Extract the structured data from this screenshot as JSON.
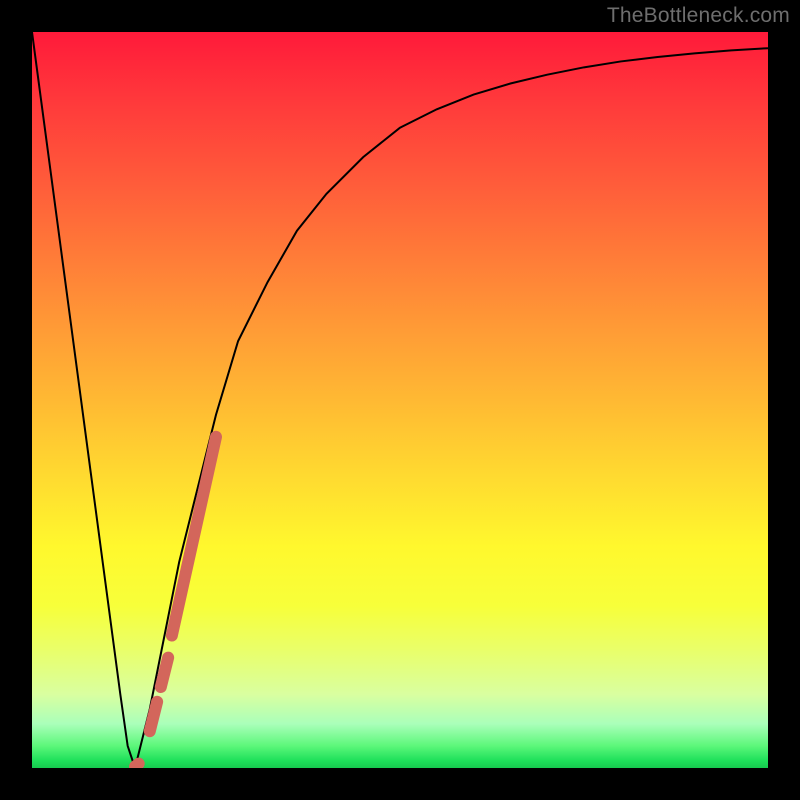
{
  "watermark": "TheBottleneck.com",
  "chart_data": {
    "type": "line",
    "title": "",
    "xlabel": "",
    "ylabel": "",
    "xlim": [
      0,
      100
    ],
    "ylim": [
      0,
      100
    ],
    "grid": false,
    "legend": false,
    "background_gradient": {
      "direction": "vertical",
      "stops": [
        {
          "pos": 0.0,
          "color": "#ff1a3a"
        },
        {
          "pos": 0.5,
          "color": "#ffb933"
        },
        {
          "pos": 0.78,
          "color": "#f7ff3a"
        },
        {
          "pos": 0.94,
          "color": "#aaffba"
        },
        {
          "pos": 1.0,
          "color": "#17c94f"
        }
      ]
    },
    "series": [
      {
        "name": "bottleneck-curve",
        "stroke": "#000000",
        "stroke_width": 2,
        "x": [
          0,
          4,
          8,
          10,
          12,
          13,
          14,
          16,
          18,
          20,
          22,
          25,
          28,
          32,
          36,
          40,
          45,
          50,
          55,
          60,
          65,
          70,
          75,
          80,
          85,
          90,
          95,
          100
        ],
        "values": [
          100,
          70,
          40,
          25,
          10,
          3,
          0,
          8,
          18,
          28,
          36,
          48,
          58,
          66,
          73,
          78,
          83,
          87,
          89.5,
          91.5,
          93,
          94.2,
          95.2,
          96,
          96.6,
          97.1,
          97.5,
          97.8
        ]
      },
      {
        "name": "highlight-dashes",
        "stroke": "#d3665b",
        "stroke_width": 12,
        "linecap": "round",
        "segments": [
          {
            "x": [
              14.0,
              14.5
            ],
            "values": [
              0.2,
              0.6
            ]
          },
          {
            "x": [
              16.0,
              17.0
            ],
            "values": [
              5.0,
              9.0
            ]
          },
          {
            "x": [
              17.5,
              18.5
            ],
            "values": [
              11.0,
              15.0
            ]
          },
          {
            "x": [
              19.0,
              25.0
            ],
            "values": [
              18.0,
              45.0
            ]
          }
        ]
      }
    ]
  }
}
